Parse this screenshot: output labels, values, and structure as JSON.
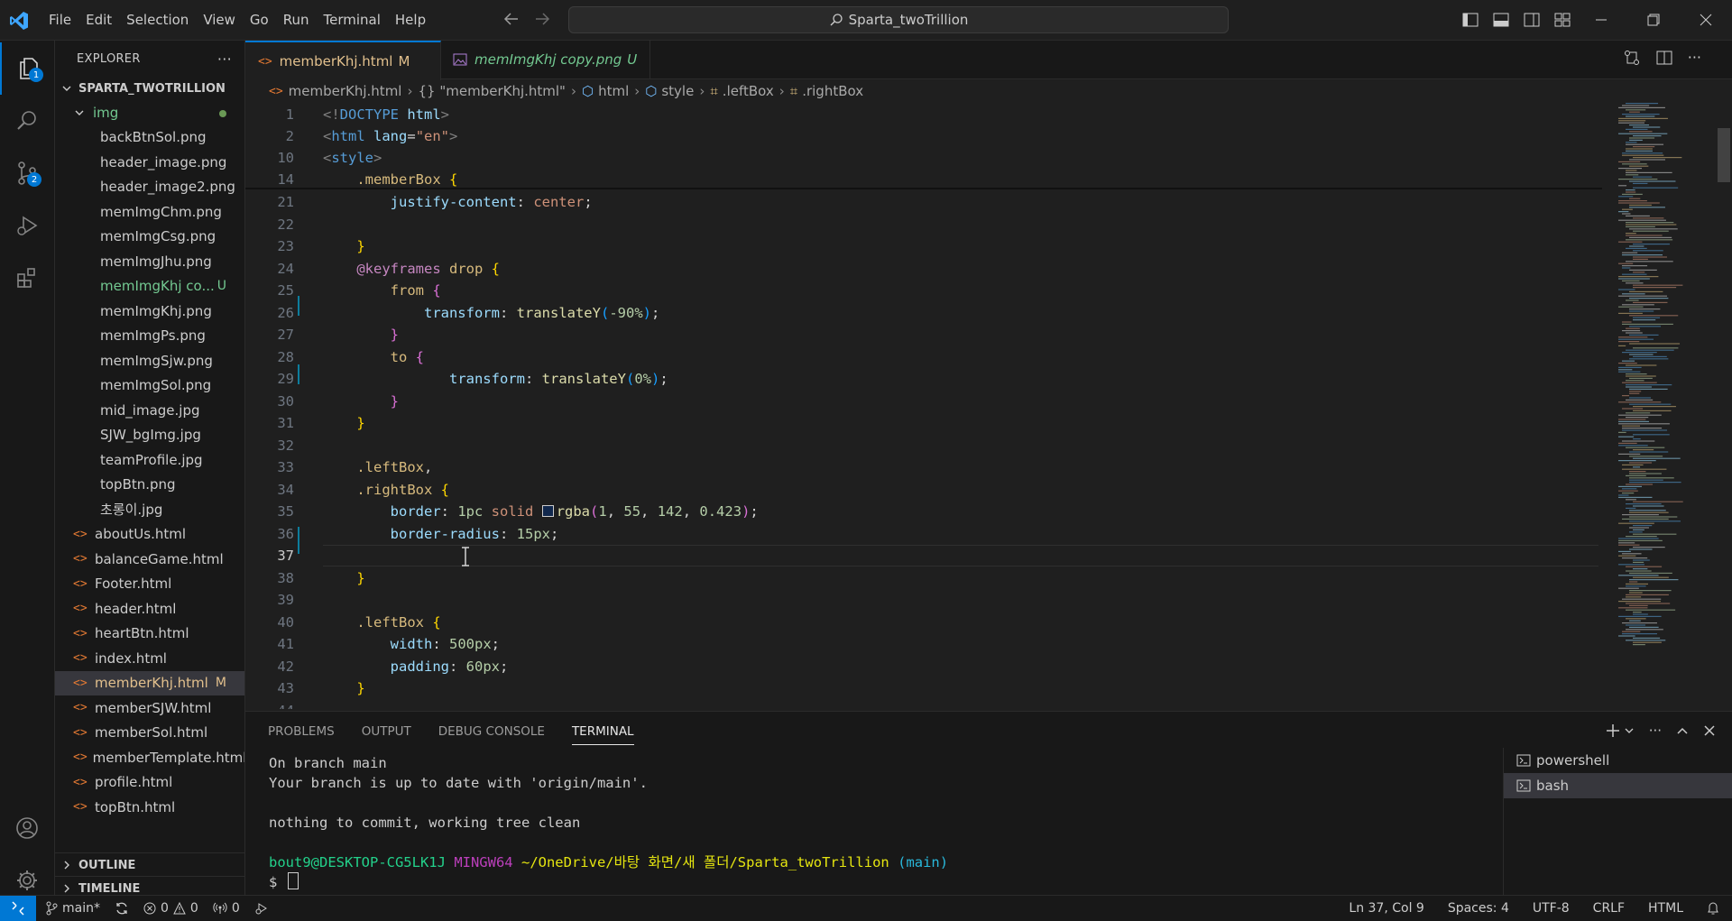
{
  "window": {
    "menu": [
      "File",
      "Edit",
      "Selection",
      "View",
      "Go",
      "Run",
      "Terminal",
      "Help"
    ],
    "search_text": "Sparta_twoTrillion"
  },
  "activity_bar": {
    "explorer_badge": "1",
    "source_control_badge": "2"
  },
  "explorer": {
    "header": "EXPLORER",
    "more": "···",
    "project": "SPARTA_TWOTRILLION",
    "folder": "img",
    "img_files": [
      {
        "name": "backBtnSol.png",
        "status": ""
      },
      {
        "name": "header_image.png",
        "status": ""
      },
      {
        "name": "header_image2.png",
        "status": ""
      },
      {
        "name": "memImgChm.png",
        "status": ""
      },
      {
        "name": "memImgCsg.png",
        "status": ""
      },
      {
        "name": "memImgJhu.png",
        "status": ""
      },
      {
        "name": "memImgKhj co...",
        "status": "U"
      },
      {
        "name": "memImgKhj.png",
        "status": ""
      },
      {
        "name": "memImgPs.png",
        "status": ""
      },
      {
        "name": "memImgSjw.png",
        "status": ""
      },
      {
        "name": "memImgSol.png",
        "status": ""
      },
      {
        "name": "mid_image.jpg",
        "status": ""
      },
      {
        "name": "SJW_bgImg.jpg",
        "status": ""
      },
      {
        "name": "teamProfile.jpg",
        "status": ""
      },
      {
        "name": "topBtn.png",
        "status": ""
      },
      {
        "name": "초롱이.jpg",
        "status": ""
      }
    ],
    "html_files": [
      {
        "name": "aboutUs.html",
        "status": ""
      },
      {
        "name": "balanceGame.html",
        "status": ""
      },
      {
        "name": "Footer.html",
        "status": ""
      },
      {
        "name": "header.html",
        "status": ""
      },
      {
        "name": "heartBtn.html",
        "status": ""
      },
      {
        "name": "index.html",
        "status": ""
      },
      {
        "name": "memberKhj.html",
        "status": "M"
      },
      {
        "name": "memberSJW.html",
        "status": ""
      },
      {
        "name": "memberSol.html",
        "status": ""
      },
      {
        "name": "memberTemplate.html",
        "status": ""
      },
      {
        "name": "profile.html",
        "status": ""
      },
      {
        "name": "topBtn.html",
        "status": ""
      }
    ],
    "outline": "OUTLINE",
    "timeline": "TIMELINE"
  },
  "tabs": [
    {
      "name": "memberKhj.html",
      "status": "M",
      "icon": "<>",
      "active": true
    },
    {
      "name": "memImgKhj copy.png",
      "status": "U",
      "icon": "image-icon",
      "active": false
    }
  ],
  "breadcrumb": [
    "memberKhj.html",
    "{} \"memberKhj.html\"",
    "html",
    "style",
    ".leftBox",
    ".rightBox"
  ],
  "editor": {
    "sticky_lines": [
      {
        "n": "1",
        "parts": [
          [
            "p-br",
            "<!"
          ],
          [
            "p-tag",
            "DOCTYPE"
          ],
          [
            "p-def",
            " "
          ],
          [
            "p-attr",
            "html"
          ],
          [
            "p-br",
            ">"
          ]
        ]
      },
      {
        "n": "2",
        "parts": [
          [
            "p-br",
            "<"
          ],
          [
            "p-tag",
            "html"
          ],
          [
            "p-def",
            " "
          ],
          [
            "p-attr",
            "lang"
          ],
          [
            "p-def",
            "="
          ],
          [
            "p-str",
            "\"en\""
          ],
          [
            "p-br",
            ">"
          ]
        ]
      },
      {
        "n": "10",
        "parts": [
          [
            "p-br",
            "<"
          ],
          [
            "p-tag",
            "style"
          ],
          [
            "p-br",
            ">"
          ]
        ]
      },
      {
        "n": "14",
        "parts": [
          [
            "p-def",
            "    "
          ],
          [
            "p-sel",
            ".memberBox"
          ],
          [
            "p-def",
            " "
          ],
          [
            "p-b1",
            "{"
          ]
        ]
      }
    ],
    "lines": [
      {
        "n": "21",
        "parts": [
          [
            "p-def",
            "        "
          ],
          [
            "p-prop",
            "justify-content"
          ],
          [
            "p-def",
            ": "
          ],
          [
            "p-val",
            "center"
          ],
          [
            "p-def",
            ";"
          ]
        ]
      },
      {
        "n": "22",
        "parts": []
      },
      {
        "n": "23",
        "parts": [
          [
            "p-def",
            "    "
          ],
          [
            "p-b1",
            "}"
          ]
        ]
      },
      {
        "n": "24",
        "parts": [
          [
            "p-def",
            "    "
          ],
          [
            "p-at",
            "@keyframes"
          ],
          [
            "p-def",
            " "
          ],
          [
            "p-sel",
            "drop"
          ],
          [
            "p-def",
            " "
          ],
          [
            "p-b1",
            "{"
          ]
        ]
      },
      {
        "n": "25",
        "parts": [
          [
            "p-def",
            "        "
          ],
          [
            "p-sel",
            "from"
          ],
          [
            "p-def",
            " "
          ],
          [
            "p-b2",
            "{"
          ]
        ]
      },
      {
        "n": "26",
        "parts": [
          [
            "p-def",
            "            "
          ],
          [
            "p-prop",
            "transform"
          ],
          [
            "p-def",
            ": "
          ],
          [
            "p-fn",
            "translateY"
          ],
          [
            "p-b3",
            "("
          ],
          [
            "p-num",
            "-90%"
          ],
          [
            "p-b3",
            ")"
          ],
          [
            "p-def",
            ";"
          ]
        ]
      },
      {
        "n": "27",
        "parts": [
          [
            "p-def",
            "        "
          ],
          [
            "p-b2",
            "}"
          ]
        ]
      },
      {
        "n": "28",
        "parts": [
          [
            "p-def",
            "        "
          ],
          [
            "p-sel",
            "to"
          ],
          [
            "p-def",
            " "
          ],
          [
            "p-b2",
            "{"
          ]
        ]
      },
      {
        "n": "29",
        "parts": [
          [
            "p-def",
            "               "
          ],
          [
            "p-prop",
            "transform"
          ],
          [
            "p-def",
            ": "
          ],
          [
            "p-fn",
            "translateY"
          ],
          [
            "p-b3",
            "("
          ],
          [
            "p-num",
            "0%"
          ],
          [
            "p-b3",
            ")"
          ],
          [
            "p-def",
            ";"
          ]
        ]
      },
      {
        "n": "30",
        "parts": [
          [
            "p-def",
            "        "
          ],
          [
            "p-b2",
            "}"
          ]
        ]
      },
      {
        "n": "31",
        "parts": [
          [
            "p-def",
            "    "
          ],
          [
            "p-b1",
            "}"
          ]
        ]
      },
      {
        "n": "32",
        "parts": []
      },
      {
        "n": "33",
        "parts": [
          [
            "p-def",
            "    "
          ],
          [
            "p-sel",
            ".leftBox"
          ],
          [
            "p-def",
            ","
          ]
        ]
      },
      {
        "n": "34",
        "parts": [
          [
            "p-def",
            "    "
          ],
          [
            "p-sel",
            ".rightBox"
          ],
          [
            "p-def",
            " "
          ],
          [
            "p-b1",
            "{"
          ]
        ]
      },
      {
        "n": "35",
        "parts": [
          [
            "p-def",
            "        "
          ],
          [
            "p-prop",
            "border"
          ],
          [
            "p-def",
            ": "
          ],
          [
            "p-num",
            "1pc"
          ],
          [
            "p-def",
            " "
          ],
          [
            "p-val",
            "solid"
          ],
          [
            "p-def",
            " "
          ],
          [
            "swatch",
            ""
          ],
          [
            "p-fn",
            "rgba"
          ],
          [
            "p-b2",
            "("
          ],
          [
            "p-num",
            "1"
          ],
          [
            "p-def",
            ", "
          ],
          [
            "p-num",
            "55"
          ],
          [
            "p-def",
            ", "
          ],
          [
            "p-num",
            "142"
          ],
          [
            "p-def",
            ", "
          ],
          [
            "p-num",
            "0.423"
          ],
          [
            "p-b2",
            ")"
          ],
          [
            "p-def",
            ";"
          ]
        ]
      },
      {
        "n": "36",
        "parts": [
          [
            "p-def",
            "        "
          ],
          [
            "p-prop",
            "border-radius"
          ],
          [
            "p-def",
            ": "
          ],
          [
            "p-num",
            "15px"
          ],
          [
            "p-def",
            ";"
          ]
        ]
      },
      {
        "n": "37",
        "parts": [],
        "current": true
      },
      {
        "n": "38",
        "parts": [
          [
            "p-def",
            "    "
          ],
          [
            "p-b1",
            "}"
          ]
        ]
      },
      {
        "n": "39",
        "parts": []
      },
      {
        "n": "40",
        "parts": [
          [
            "p-def",
            "    "
          ],
          [
            "p-sel",
            ".leftBox"
          ],
          [
            "p-def",
            " "
          ],
          [
            "p-b1",
            "{"
          ]
        ]
      },
      {
        "n": "41",
        "parts": [
          [
            "p-def",
            "        "
          ],
          [
            "p-prop",
            "width"
          ],
          [
            "p-def",
            ": "
          ],
          [
            "p-num",
            "500px"
          ],
          [
            "p-def",
            ";"
          ]
        ]
      },
      {
        "n": "42",
        "parts": [
          [
            "p-def",
            "        "
          ],
          [
            "p-prop",
            "padding"
          ],
          [
            "p-def",
            ": "
          ],
          [
            "p-num",
            "60px"
          ],
          [
            "p-def",
            ";"
          ]
        ]
      },
      {
        "n": "43",
        "parts": [
          [
            "p-def",
            "    "
          ],
          [
            "p-b1",
            "}"
          ]
        ]
      },
      {
        "n": "44",
        "parts": []
      }
    ]
  },
  "panel": {
    "tabs": [
      {
        "label": "PROBLEMS",
        "active": false
      },
      {
        "label": "OUTPUT",
        "active": false
      },
      {
        "label": "DEBUG CONSOLE",
        "active": false
      },
      {
        "label": "TERMINAL",
        "active": true
      }
    ],
    "terminal": {
      "line1": "On branch main",
      "line2": "Your branch is up to date with 'origin/main'.",
      "line3": "nothing to commit, working tree clean",
      "prompt_user": "bout9@DESKTOP-CG5LK1J",
      "prompt_shell": "MINGW64",
      "prompt_path": "~/OneDrive/바탕 화면/새 폴더/Sparta_twoTrillion",
      "prompt_branch": "(main)",
      "prompt_symbol": "$"
    },
    "terminals": [
      {
        "label": "powershell",
        "selected": false
      },
      {
        "label": "bash",
        "selected": true
      }
    ]
  },
  "statusbar": {
    "branch": "main*",
    "errors": "0",
    "warnings": "0",
    "ports": "0",
    "position": "Ln 37, Col 9",
    "spaces": "Spaces: 4",
    "encoding": "UTF-8",
    "eol": "CRLF",
    "language": "HTML"
  }
}
